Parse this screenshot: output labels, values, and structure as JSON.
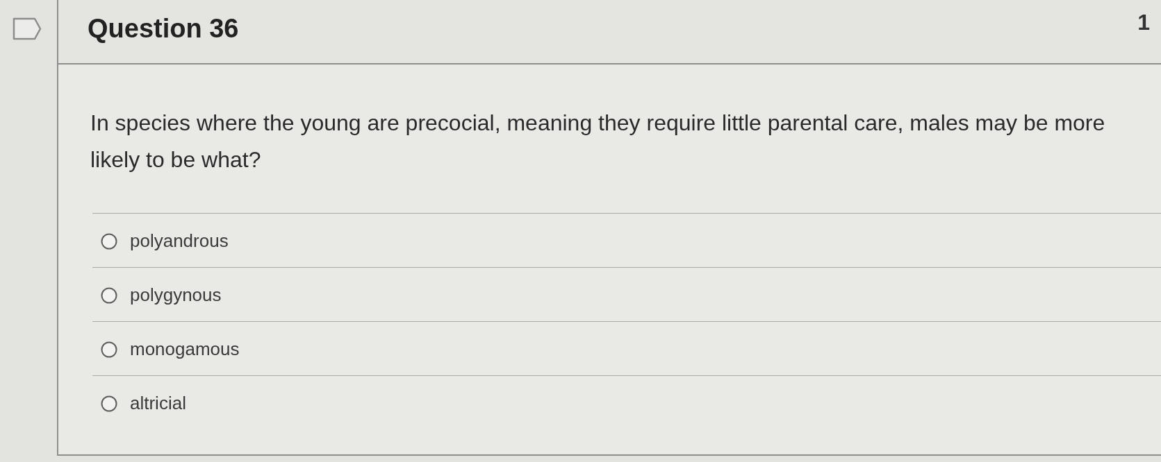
{
  "header": {
    "title": "Question 36",
    "points": "1"
  },
  "prompt": "In species where the young are precocial, meaning they require little parental care, males may be more likely to be what?",
  "options": [
    {
      "label": "polyandrous",
      "selected": false
    },
    {
      "label": "polygynous",
      "selected": false
    },
    {
      "label": "monogamous",
      "selected": false
    },
    {
      "label": "altricial",
      "selected": false
    }
  ]
}
